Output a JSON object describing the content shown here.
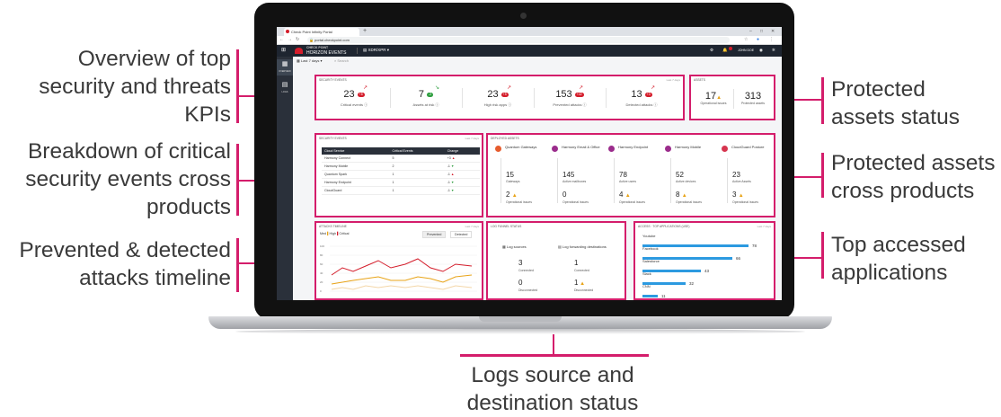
{
  "callouts": {
    "overview": [
      "Overview of top",
      "security and threats",
      "KPIs"
    ],
    "breakdown": [
      "Breakdown of critical",
      "security events cross",
      "products"
    ],
    "timeline": [
      "Prevented & detected",
      "attacks timeline"
    ],
    "logs": [
      "Logs source and",
      "destination status"
    ],
    "protected_status": [
      "Protected",
      "assets status"
    ],
    "protected_cross": [
      "Protected assets",
      "cross products"
    ],
    "top_apps": [
      "Top accessed",
      "applications"
    ]
  },
  "browser": {
    "tab_title": "Check Point Infinity Portal",
    "url": "portal.checkpoint.com"
  },
  "header": {
    "brand_line1": "CHECK POINT",
    "brand_line2": "HORIZON EVENTS",
    "app_name": "XDR/XPR",
    "user": "JOHN DOE"
  },
  "sidebar": {
    "items": [
      {
        "label": "OVERVIEW",
        "icon": "grid-icon"
      },
      {
        "label": "LOGS",
        "icon": "document-icon"
      }
    ]
  },
  "toolbar": {
    "time_range": "Last 7 days",
    "search_placeholder": "Search"
  },
  "security_events": {
    "title": "SECURITY EVENTS",
    "range": "Last 7 days",
    "kpis": [
      {
        "value": "23",
        "change": "+8",
        "label": "Critical events",
        "trend": "up",
        "color": "#d41d2b"
      },
      {
        "value": "7",
        "change": "-2",
        "label": "Assets at risk",
        "trend": "down",
        "color": "#2e9e3f"
      },
      {
        "value": "23",
        "change": "+5",
        "label": "High risk apps",
        "trend": "up",
        "color": "#d41d2b"
      },
      {
        "value": "153",
        "change": "+42",
        "label": "Prevented attacks",
        "trend": "up",
        "color": "#d41d2b"
      },
      {
        "value": "13",
        "change": "+3",
        "label": "Detected attacks",
        "trend": "up",
        "color": "#d41d2b"
      }
    ]
  },
  "assets": {
    "title": "ASSETS",
    "operational_issues": "17",
    "operational_issues_label": "Operational issues",
    "protected_assets": "313",
    "protected_assets_label": "Protected assets"
  },
  "critical_events": {
    "title": "SECURITY EVENTS",
    "range": "Last 7 days",
    "columns": [
      "Cloud Service",
      "Critical Events",
      "Change"
    ],
    "rows": [
      {
        "service": "Harmony Connect",
        "events": "5",
        "change": "+3",
        "trend": "up"
      },
      {
        "service": "Harmony Mobile",
        "events": "2",
        "change": "-1",
        "trend": "down"
      },
      {
        "service": "Quantum Spark",
        "events": "1",
        "change": "-1",
        "trend": "up"
      },
      {
        "service": "Harmony Endpoint",
        "events": "1",
        "change": "-1",
        "trend": "down"
      },
      {
        "service": "CloudGuard",
        "events": "1",
        "change": "-1",
        "trend": "down"
      }
    ]
  },
  "deployed_assets": {
    "title": "DEPLOYED ASSETS",
    "products": [
      {
        "name": "Quantum Gateways",
        "count": "15",
        "count_label": "Gateways",
        "issues": "2",
        "issues_label": "Operational issues",
        "color": "#e65c2e",
        "warn": true
      },
      {
        "name": "Harmony Email & Office",
        "count": "145",
        "count_label": "Active mailboxes",
        "issues": "0",
        "issues_label": "Operational issues",
        "color": "#9b2c8c",
        "warn": false
      },
      {
        "name": "Harmony Endpoint",
        "count": "78",
        "count_label": "Active users",
        "issues": "4",
        "issues_label": "Operational issues",
        "color": "#9b2c8c",
        "warn": true
      },
      {
        "name": "Harmony Mobile",
        "count": "52",
        "count_label": "Active devices",
        "issues": "8",
        "issues_label": "Operational issues",
        "color": "#9b2c8c",
        "warn": true
      },
      {
        "name": "CloudGuard Posture",
        "count": "23",
        "count_label": "Active Assets",
        "issues": "3",
        "issues_label": "Operational issues",
        "color": "#d6354f",
        "warn": true
      }
    ]
  },
  "timeline": {
    "title": "ATTACKS TIMELINE",
    "range": "Last 7 days",
    "legend": [
      "Med",
      "High",
      "Critical"
    ],
    "tabs": [
      "Prevented",
      "Detected"
    ],
    "active_tab": "Prevented",
    "y_ticks": [
      "100",
      "80",
      "60",
      "40",
      "20",
      "0"
    ]
  },
  "log_status": {
    "title": "LOG FUNNEL STATUS",
    "sources_label": "Log sources",
    "dest_label": "Log forwarding destinations",
    "sources_connected": "3",
    "sources_disconnected": "0",
    "dest_connected": "1",
    "dest_disconnected": "1",
    "connected_label": "Connected",
    "disconnected_label": "Disconnected"
  },
  "top_apps": {
    "title": "ACCESS · TOP APPLICATIONS (USE)",
    "range": "Last 7 days",
    "max": 78,
    "items": [
      {
        "name": "Youtube",
        "value": 78
      },
      {
        "name": "Facebook",
        "value": 66
      },
      {
        "name": "Salesforce",
        "value": 43
      },
      {
        "name": "Slack",
        "value": 32
      },
      {
        "name": "CNN",
        "value": 11
      }
    ]
  },
  "colors": {
    "accent": "#d41d6b",
    "critical": "#d41d2b",
    "bar": "#2c9ae0"
  }
}
